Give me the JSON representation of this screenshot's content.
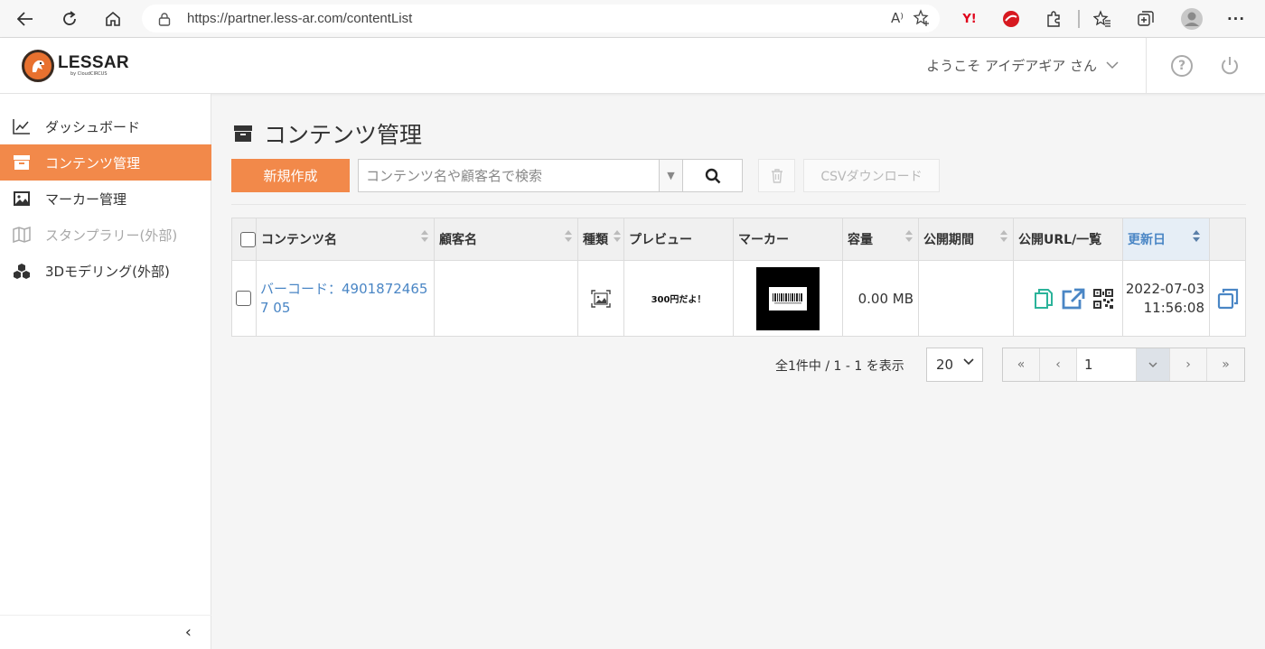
{
  "browser": {
    "url": "https://partner.less-ar.com/contentList",
    "read_aloud_label": "A⁾"
  },
  "header": {
    "logo_text": "LESSAR",
    "logo_sub": "by CloudCIRCUS",
    "welcome": "ようこそ アイデアギア さん",
    "help_label": "?"
  },
  "sidebar": {
    "items": [
      {
        "label": "ダッシュボード",
        "icon": "chart-line-icon",
        "state": "normal"
      },
      {
        "label": "コンテンツ管理",
        "icon": "archive-icon",
        "state": "active"
      },
      {
        "label": "マーカー管理",
        "icon": "image-icon",
        "state": "normal"
      },
      {
        "label": "スタンプラリー(外部)",
        "icon": "map-icon",
        "state": "disabled"
      },
      {
        "label": "3Dモデリング(外部)",
        "icon": "cubes-icon",
        "state": "normal"
      }
    ],
    "collapse_label": "‹"
  },
  "main": {
    "title": "コンテンツ管理",
    "new_button": "新規作成",
    "search_placeholder": "コンテンツ名や顧客名で検索",
    "csv_button": "CSVダウンロード"
  },
  "table": {
    "headers": {
      "name": "コンテンツ名",
      "customer": "顧客名",
      "type": "種類",
      "preview": "プレビュー",
      "marker": "マーカー",
      "size": "容量",
      "period": "公開期間",
      "url": "公開URL/一覧",
      "updated": "更新日"
    },
    "rows": [
      {
        "name": "バーコード：49018724657 05",
        "customer": "",
        "type_icon": "image-icon",
        "preview_text": "300円だよ！",
        "size": "0.00 MB",
        "period": "",
        "updated_date": "2022-07-03",
        "updated_time": "11:56:08"
      }
    ]
  },
  "pager": {
    "info": "全1件中 / 1 - 1 を表示",
    "per_page": "20",
    "page": "1",
    "first": "«",
    "prev": "‹",
    "next": "›",
    "last": "»"
  },
  "colors": {
    "accent": "#f2894a",
    "link": "#4a86c5",
    "copy_icon": "#2bb39a"
  }
}
